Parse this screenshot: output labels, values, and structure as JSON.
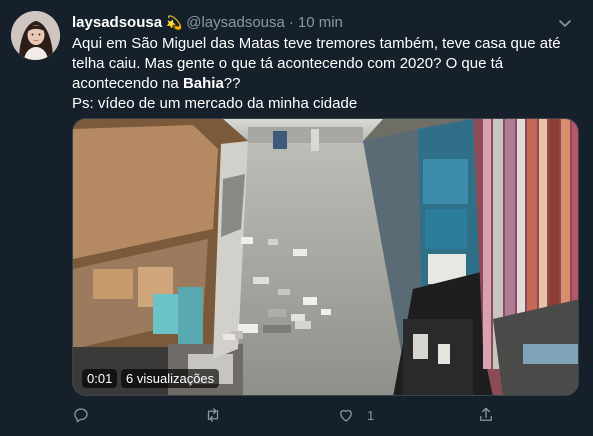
{
  "tweet": {
    "display_name": "laysadsousa",
    "badge_icon": "comet-emoji",
    "handle": "@laysadsousa",
    "separator": "·",
    "time": "10 min",
    "text_lines": [
      "Aqui em São Miguel das Matas teve tremores também, teve casa que até",
      "telha caiu. Mas gente o que tá acontecendo com 2020? O que tá",
      "acontecendo na ",
      "Ps: vídeo de um mercado da minha cidade"
    ],
    "bold_word": "Bahia",
    "bold_suffix": "??"
  },
  "media": {
    "video_time": "0:01",
    "views": "6 visualizações"
  },
  "actions": {
    "reply_icon": "reply-icon",
    "retweet_icon": "retweet-icon",
    "like_icon": "heart-icon",
    "like_count": "1",
    "share_icon": "share-icon"
  },
  "colors": {
    "background": "#15202b",
    "secondary_text": "#8899a6",
    "border": "#38444d"
  }
}
